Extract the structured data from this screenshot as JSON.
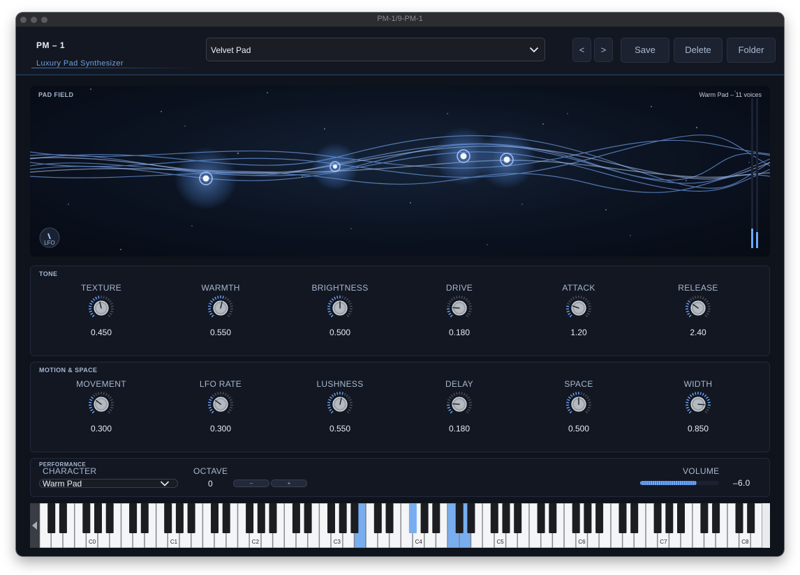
{
  "window": {
    "title": "PM-1/9-PM-1"
  },
  "header": {
    "brand": "PM – 1",
    "subtitle": "Luxury Pad Synthesizer",
    "preset": "Velvet Pad",
    "prev_label": "<",
    "next_label": ">",
    "save_label": "Save",
    "delete_label": "Delete",
    "folder_label": "Folder"
  },
  "pad_field": {
    "title": "PAD FIELD",
    "info": "Warm Pad  –  11 voices",
    "lfo_label": "LFO",
    "accent": "#6fa8ff"
  },
  "tone": {
    "title": "TONE",
    "knobs": [
      {
        "label": "TEXTURE",
        "value": "0.450",
        "level": 0.45
      },
      {
        "label": "WARMTH",
        "value": "0.550",
        "level": 0.55
      },
      {
        "label": "BRIGHTNESS",
        "value": "0.500",
        "level": 0.5
      },
      {
        "label": "DRIVE",
        "value": "0.180",
        "level": 0.18
      },
      {
        "label": "ATTACK",
        "value": "1.20",
        "level": 0.24
      },
      {
        "label": "RELEASE",
        "value": "2.40",
        "level": 0.3
      }
    ]
  },
  "motion": {
    "title": "MOTION  &  SPACE",
    "knobs": [
      {
        "label": "MOVEMENT",
        "value": "0.300",
        "level": 0.3
      },
      {
        "label": "LFO RATE",
        "value": "0.300",
        "level": 0.3
      },
      {
        "label": "LUSHNESS",
        "value": "0.550",
        "level": 0.55
      },
      {
        "label": "DELAY",
        "value": "0.180",
        "level": 0.18
      },
      {
        "label": "SPACE",
        "value": "0.500",
        "level": 0.5
      },
      {
        "label": "WIDTH",
        "value": "0.850",
        "level": 0.85
      }
    ]
  },
  "performance": {
    "title": "PERFORMANCE",
    "character_label": "CHARACTER",
    "character_value": "Warm Pad",
    "octave_label": "OCTAVE",
    "octave_value": "0",
    "octave_down": "–",
    "octave_up": "+",
    "volume_label": "VOLUME",
    "volume_value": "–6.0",
    "volume_level": 0.72
  },
  "keyboard": {
    "octave_labels": [
      "C0",
      "C1",
      "C2",
      "C3",
      "C4",
      "C5",
      "C6",
      "C7",
      "C8"
    ],
    "active_keys": [
      "B3",
      "F#4",
      "C5",
      "D5"
    ],
    "active_color": "#78aef0"
  }
}
